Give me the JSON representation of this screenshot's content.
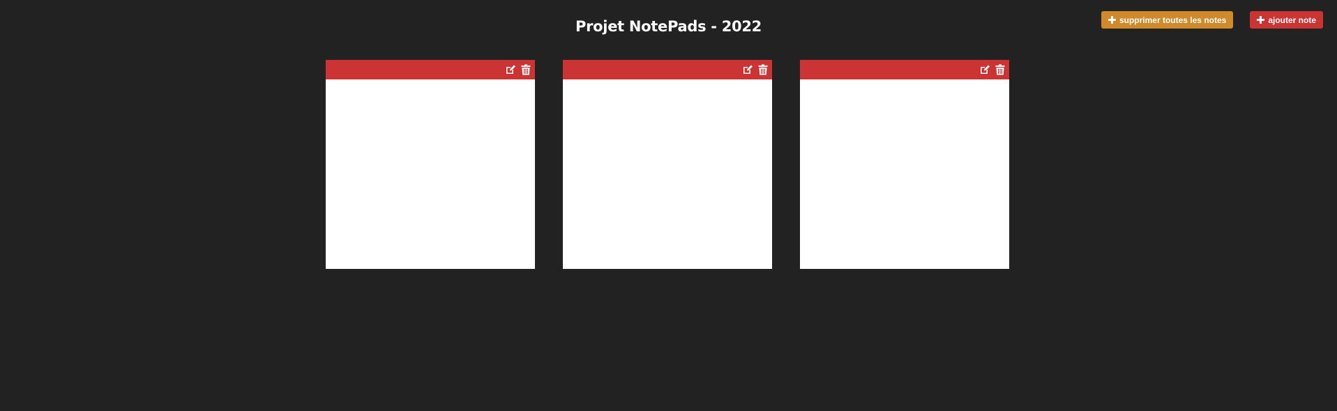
{
  "header": {
    "title": "Projet NotePads - 2022"
  },
  "actions": {
    "clear_all_label": "supprimer toutes les notes",
    "add_note_label": "ajouter note"
  },
  "notes": [
    {
      "content": ""
    },
    {
      "content": ""
    },
    {
      "content": ""
    }
  ],
  "icons": {
    "add": "plus-icon",
    "edit": "edit-icon",
    "delete": "trash-icon"
  },
  "colors": {
    "background": "#222222",
    "accent_red": "#cc3333",
    "accent_orange": "#d08a2a",
    "note_background": "#ffffff"
  }
}
